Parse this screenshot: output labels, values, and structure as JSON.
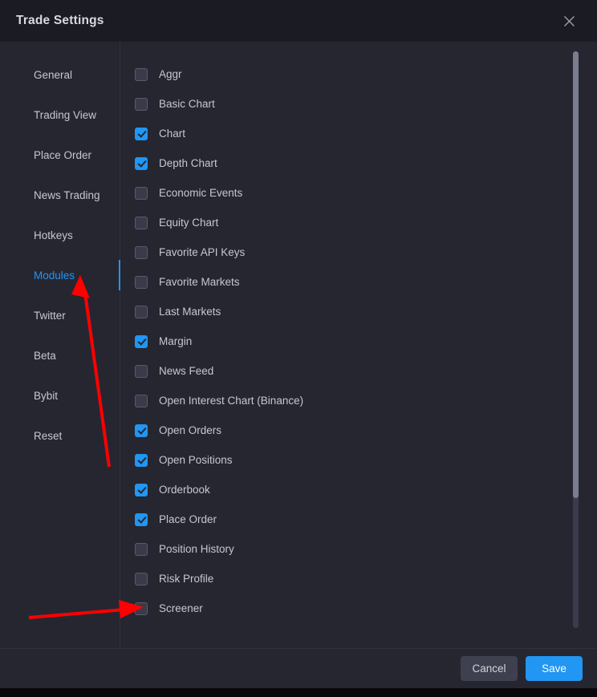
{
  "dialog": {
    "title": "Trade Settings",
    "close_icon": "close-icon"
  },
  "sidebar": {
    "items": [
      {
        "label": "General",
        "active": false
      },
      {
        "label": "Trading View",
        "active": false
      },
      {
        "label": "Place Order",
        "active": false
      },
      {
        "label": "News Trading",
        "active": false
      },
      {
        "label": "Hotkeys",
        "active": false
      },
      {
        "label": "Modules",
        "active": true
      },
      {
        "label": "Twitter",
        "active": false
      },
      {
        "label": "Beta",
        "active": false
      },
      {
        "label": "Bybit",
        "active": false
      },
      {
        "label": "Reset",
        "active": false
      }
    ]
  },
  "modules": {
    "items": [
      {
        "label": "Aggr",
        "checked": false
      },
      {
        "label": "Basic Chart",
        "checked": false
      },
      {
        "label": "Chart",
        "checked": true
      },
      {
        "label": "Depth Chart",
        "checked": true
      },
      {
        "label": "Economic Events",
        "checked": false
      },
      {
        "label": "Equity Chart",
        "checked": false
      },
      {
        "label": "Favorite API Keys",
        "checked": false
      },
      {
        "label": "Favorite Markets",
        "checked": false
      },
      {
        "label": "Last Markets",
        "checked": false
      },
      {
        "label": "Margin",
        "checked": true
      },
      {
        "label": "News Feed",
        "checked": false
      },
      {
        "label": "Open Interest Chart (Binance)",
        "checked": false
      },
      {
        "label": "Open Orders",
        "checked": true
      },
      {
        "label": "Open Positions",
        "checked": true
      },
      {
        "label": "Orderbook",
        "checked": true
      },
      {
        "label": "Place Order",
        "checked": true
      },
      {
        "label": "Position History",
        "checked": false
      },
      {
        "label": "Risk Profile",
        "checked": false
      },
      {
        "label": "Screener",
        "checked": false
      }
    ]
  },
  "footer": {
    "cancel_label": "Cancel",
    "save_label": "Save"
  },
  "annotations": {
    "color": "#ff0000",
    "arrows": [
      {
        "name": "arrow-to-modules",
        "target": "Modules"
      },
      {
        "name": "arrow-to-screener",
        "target": "Screener"
      }
    ]
  },
  "colors": {
    "accent": "#2196f3",
    "header_bg": "#1b1b24",
    "body_bg": "#262631",
    "text": "#c5c8ce",
    "annotation": "#ff0000"
  }
}
